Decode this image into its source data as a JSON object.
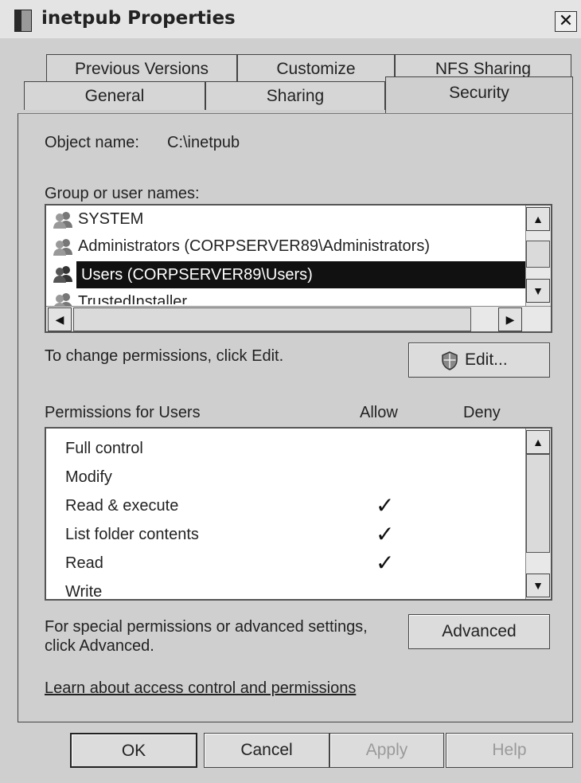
{
  "window": {
    "title": "inetpub Properties",
    "close_label": "✕"
  },
  "tabs": {
    "row1": [
      "Previous Versions",
      "Customize",
      "NFS Sharing"
    ],
    "row2": [
      "General",
      "Sharing",
      "Security"
    ],
    "active": "Security"
  },
  "object": {
    "label": "Object name:",
    "value": "C:\\inetpub"
  },
  "groups": {
    "label": "Group or user names:",
    "items": [
      "SYSTEM",
      "Administrators (CORPSERVER89\\Administrators)",
      "Users (CORPSERVER89\\Users)",
      "TrustedInstaller"
    ],
    "selected": "Users (CORPSERVER89\\Users)"
  },
  "change": {
    "text": "To change permissions, click Edit.",
    "edit_label": "Edit..."
  },
  "permissions": {
    "header": "Permissions for Users",
    "allow_label": "Allow",
    "deny_label": "Deny",
    "rows": [
      {
        "name": "Full control",
        "allow": false,
        "deny": false
      },
      {
        "name": "Modify",
        "allow": false,
        "deny": false
      },
      {
        "name": "Read & execute",
        "allow": true,
        "deny": false
      },
      {
        "name": "List folder contents",
        "allow": true,
        "deny": false
      },
      {
        "name": "Read",
        "allow": true,
        "deny": false
      },
      {
        "name": "Write",
        "allow": false,
        "deny": false
      }
    ],
    "check_glyph": "✓"
  },
  "advanced": {
    "text_line1": "For special permissions or advanced settings,",
    "text_line2": "click Advanced.",
    "button_label": "Advanced"
  },
  "learn_link": "Learn about access control and permissions",
  "buttons": {
    "ok": "OK",
    "cancel": "Cancel",
    "apply": "Apply",
    "help": "Help"
  },
  "icons": {
    "title": "folder-icon",
    "user": "user-group-icon",
    "shield": "shield-icon",
    "scroll_up": "▲",
    "scroll_down": "▼",
    "scroll_left": "◀",
    "scroll_right": "▶"
  }
}
